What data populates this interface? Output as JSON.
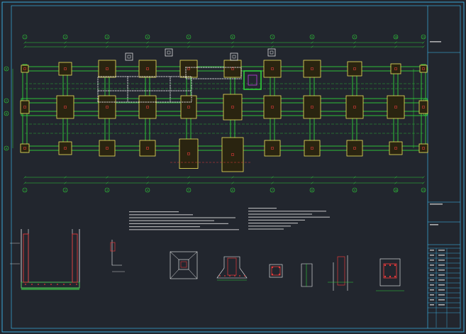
{
  "drawing": {
    "axis_top": [
      "1",
      "2",
      "3",
      "4",
      "5",
      "6",
      "7",
      "8",
      "9",
      "10",
      "11"
    ],
    "axis_left": [
      "D",
      "C",
      "B",
      "A"
    ],
    "plan_title": "",
    "notes_left_title": "",
    "notes_right_title": "",
    "section_caption_1": "",
    "section_caption_2": "",
    "title_block": {
      "project": "",
      "drawing_name": "",
      "rows": [
        "",
        "",
        "",
        "",
        "",
        ""
      ]
    }
  },
  "colors": {
    "background": "#22262e",
    "grid_line": "#2fd13a",
    "footing": "#f0e45a",
    "column": "#e23a3a",
    "frame": "#3fc6ff",
    "text": "#f2f2f2",
    "highlight": "#c040e0"
  }
}
